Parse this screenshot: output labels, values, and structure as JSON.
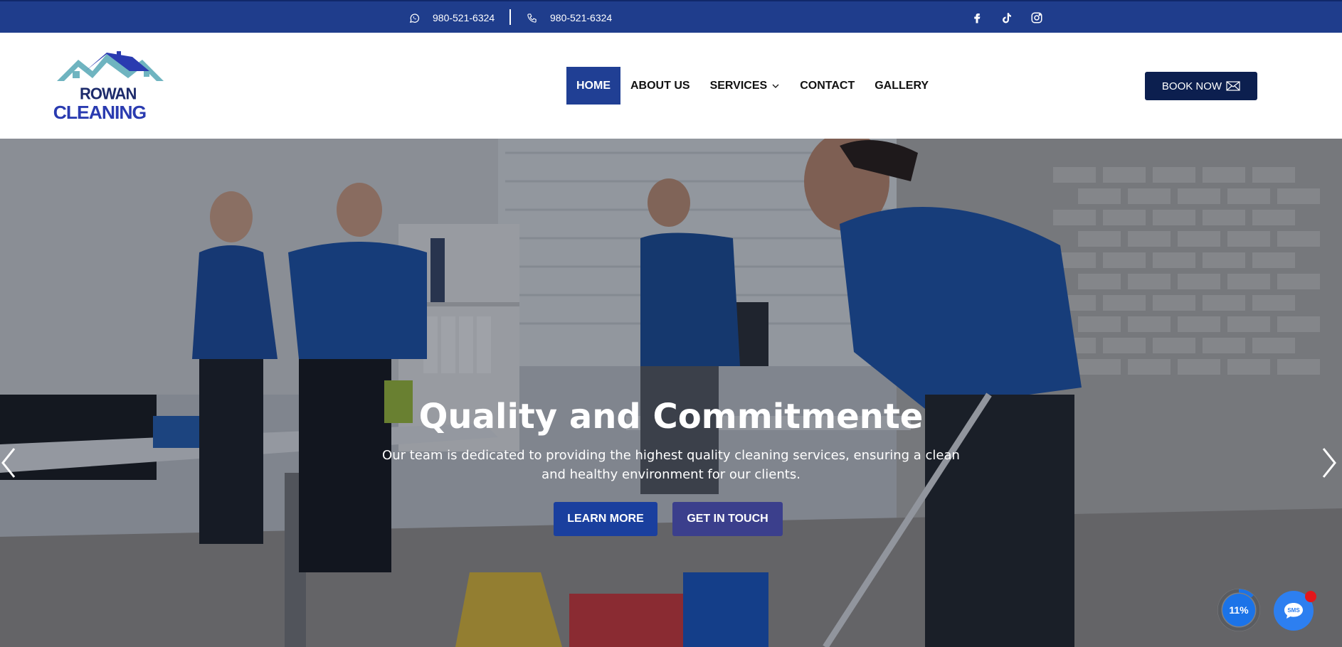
{
  "topbar": {
    "whatsapp_phone": "980-521-6324",
    "phone": "980-521-6324",
    "social": [
      "facebook-icon",
      "tiktok-icon",
      "instagram-icon"
    ],
    "bg_color": "#1f3d8c"
  },
  "logo": {
    "line1": "ROWAN",
    "line2": "CLEANING"
  },
  "nav": {
    "items": [
      "HOME",
      "ABOUT US",
      "SERVICES",
      "CONTACT",
      "GALLERY"
    ],
    "active": "HOME"
  },
  "book_now": "BOOK NOW",
  "hero": {
    "title": "Quality and Commitmente",
    "subtitle": "Our team is dedicated to providing the highest quality cleaning services, ensuring a clean and healthy environment for our clients.",
    "learn_more": "LEARN MORE",
    "get_in_touch": "GET IN TOUCH"
  },
  "widgets": {
    "scroll_progress": "11%",
    "sms_label": "SMS"
  },
  "colors": {
    "primary": "#203f94",
    "dark": "#0c1f4f",
    "secondary_button": "#3b3f8c"
  }
}
